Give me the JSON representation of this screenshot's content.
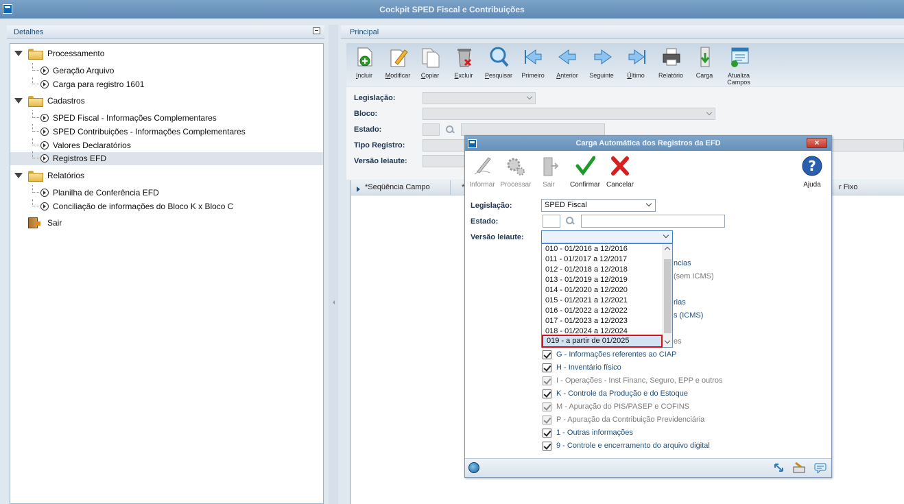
{
  "window": {
    "title": "Cockpit SPED Fiscal e Contribuições"
  },
  "left_panel": {
    "header": "Detalhes",
    "tree": [
      {
        "type": "group",
        "label": "Processamento"
      },
      {
        "type": "leaf",
        "label": "Geração Arquivo"
      },
      {
        "type": "leaf",
        "label": "Carga para registro 1601"
      },
      {
        "type": "group",
        "label": "Cadastros"
      },
      {
        "type": "leaf",
        "label": "SPED Fiscal - Informações Complementares"
      },
      {
        "type": "leaf",
        "label": "SPED Contribuições - Informações Complementares"
      },
      {
        "type": "leaf",
        "label": "Valores Declaratórios"
      },
      {
        "type": "leaf",
        "label": "Registros EFD",
        "selected": true
      },
      {
        "type": "group",
        "label": "Relatórios"
      },
      {
        "type": "leaf",
        "label": "Planilha de Conferência EFD"
      },
      {
        "type": "leaf",
        "label": "Conciliação de informações do Bloco K x Bloco C"
      },
      {
        "type": "exit",
        "label": "Sair"
      }
    ]
  },
  "right_panel": {
    "header": "Principal",
    "toolbar": [
      {
        "label": "Incluir",
        "icon": "add-doc-icon"
      },
      {
        "label": "Modificar",
        "icon": "edit-doc-icon"
      },
      {
        "label": "Copiar",
        "icon": "copy-doc-icon"
      },
      {
        "label": "Excluir",
        "icon": "trash-icon"
      },
      {
        "label": "Pesquisar",
        "icon": "magnifier-icon"
      },
      {
        "label": "Primeiro",
        "icon": "first-arrow-icon"
      },
      {
        "label": "Anterior",
        "icon": "prev-arrow-icon"
      },
      {
        "label": "Seguinte",
        "icon": "next-arrow-icon"
      },
      {
        "label": "Último",
        "icon": "last-arrow-icon"
      },
      {
        "label": "Relatório",
        "icon": "printer-icon"
      },
      {
        "label": "Carga",
        "icon": "load-icon"
      },
      {
        "label": "Atualiza Campos",
        "icon": "refresh-fields-icon"
      }
    ],
    "form": {
      "legislacao": "Legislação:",
      "bloco": "Bloco:",
      "estado": "Estado:",
      "tipo_registro": "Tipo Registro:",
      "versao_leiaute": "Versão leiaute:"
    },
    "grid": {
      "col1": "*Seqüência Campo",
      "col2_fragment": "*",
      "col_right": "r Fixo"
    }
  },
  "dialog": {
    "title": "Carga Automática dos Registros da EFD",
    "close": "×",
    "toolbar": [
      {
        "label": "Informar",
        "enabled": false,
        "icon": "pen-icon"
      },
      {
        "label": "Processar",
        "enabled": false,
        "icon": "gears-icon"
      },
      {
        "label": "Sair",
        "enabled": false,
        "icon": "exit-door-icon"
      },
      {
        "label": "Confirmar",
        "enabled": true,
        "icon": "check-icon"
      },
      {
        "label": "Cancelar",
        "enabled": true,
        "icon": "x-icon"
      },
      {
        "label": "Ajuda",
        "enabled": true,
        "icon": "help-icon"
      }
    ],
    "fields": {
      "legislacao_label": "Legislação:",
      "legislacao_value": "SPED Fiscal",
      "estado_label": "Estado:",
      "versao_label": "Versão leiaute:",
      "versao_value": ""
    },
    "dropdown_options": [
      "010 - 01/2016 a 12/2016",
      "011 - 01/2017 a 12/2017",
      "012 - 01/2018 a 12/2018",
      "013 - 01/2019 a 12/2019",
      "014 - 01/2020 a 12/2020",
      "015 - 01/2021 a 12/2021",
      "016 - 01/2022 a 12/2022",
      "017 - 01/2023 a 12/2023",
      "018 - 01/2024 a 12/2024",
      "019 - a partir de 01/2025"
    ],
    "highlighted_option": "019 - a partir de 01/2025",
    "obscured_peeks": [
      "ncias",
      "(sem ICMS)",
      "rias",
      "s (ICMS)",
      "es"
    ],
    "checkboxes": [
      {
        "label": "G - Informações referentes ao CIAP",
        "enabled": true
      },
      {
        "label": "H - Inventário físico",
        "enabled": true
      },
      {
        "label": "I - Operações - Inst Financ, Seguro, EPP e outros",
        "enabled": false
      },
      {
        "label": "K - Controle da Produção e do Estoque",
        "enabled": true
      },
      {
        "label": "M - Apuração do PIS/PASEP e COFINS",
        "enabled": false
      },
      {
        "label": "P - Apuração da Contribuição Previdenciária",
        "enabled": false
      },
      {
        "label": "1 - Outras informações",
        "enabled": true
      },
      {
        "label": "9 - Controle e encerramento do arquivo digital",
        "enabled": true
      }
    ]
  },
  "colors": {
    "accent": "#1f4e79",
    "highlight_border": "#d0131a",
    "titlebar": "#6690ba"
  }
}
